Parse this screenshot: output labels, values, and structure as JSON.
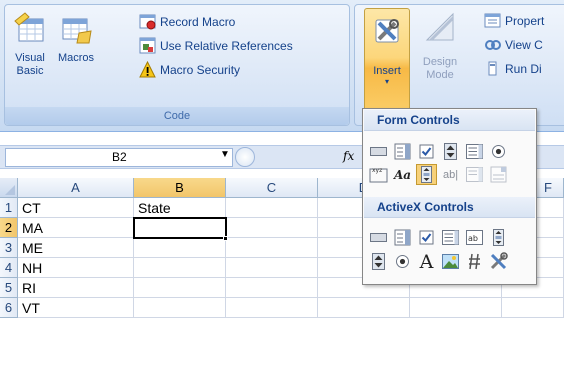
{
  "ribbon": {
    "code_group": {
      "label": "Code",
      "visual_basic": {
        "line1": "Visual",
        "line2": "Basic"
      },
      "macros": "Macros",
      "record_macro": "Record Macro",
      "relative_refs": "Use Relative References",
      "macro_security": "Macro Security"
    },
    "controls_group": {
      "insert": "Insert",
      "design_mode": {
        "line1": "Design",
        "line2": "Mode"
      },
      "properties": "Propert",
      "view_code": "View C",
      "run_dialog": "Run Di"
    }
  },
  "formula_bar": {
    "name_box": "B2",
    "fx": "fx"
  },
  "grid": {
    "columns": [
      "A",
      "B",
      "C",
      "D",
      "E",
      "F"
    ],
    "rows": [
      "1",
      "2",
      "3",
      "4",
      "5",
      "6"
    ],
    "cells": [
      [
        "CT",
        "State"
      ],
      [
        "MA",
        ""
      ],
      [
        "ME",
        ""
      ],
      [
        "NH",
        ""
      ],
      [
        "RI",
        ""
      ],
      [
        "VT",
        ""
      ]
    ],
    "selected_cell": "B2"
  },
  "dropdown": {
    "form_controls": "Form Controls",
    "activex_controls": "ActiveX Controls",
    "form_row1": [
      "button-icon",
      "combo-box-icon",
      "check-box-icon",
      "spin-button-icon",
      "list-box-icon",
      "option-button-icon"
    ],
    "form_row2": [
      "group-box-icon",
      "label-icon",
      "scroll-bar-icon",
      "text-field-icon",
      "combo-list-edit-icon",
      "combo-drop-down-edit-icon"
    ],
    "activex_row1": [
      "command-button-icon",
      "combo-box-icon",
      "check-box-icon",
      "list-box-icon",
      "text-box-icon",
      "scroll-bar-icon"
    ],
    "activex_row2": [
      "spin-button-icon",
      "option-button-icon",
      "label-icon",
      "image-icon",
      "toggle-button-icon",
      "more-controls-icon"
    ],
    "label_glyph": "Aa",
    "text_glyph": "ab|",
    "activex_label_glyph": "A"
  }
}
